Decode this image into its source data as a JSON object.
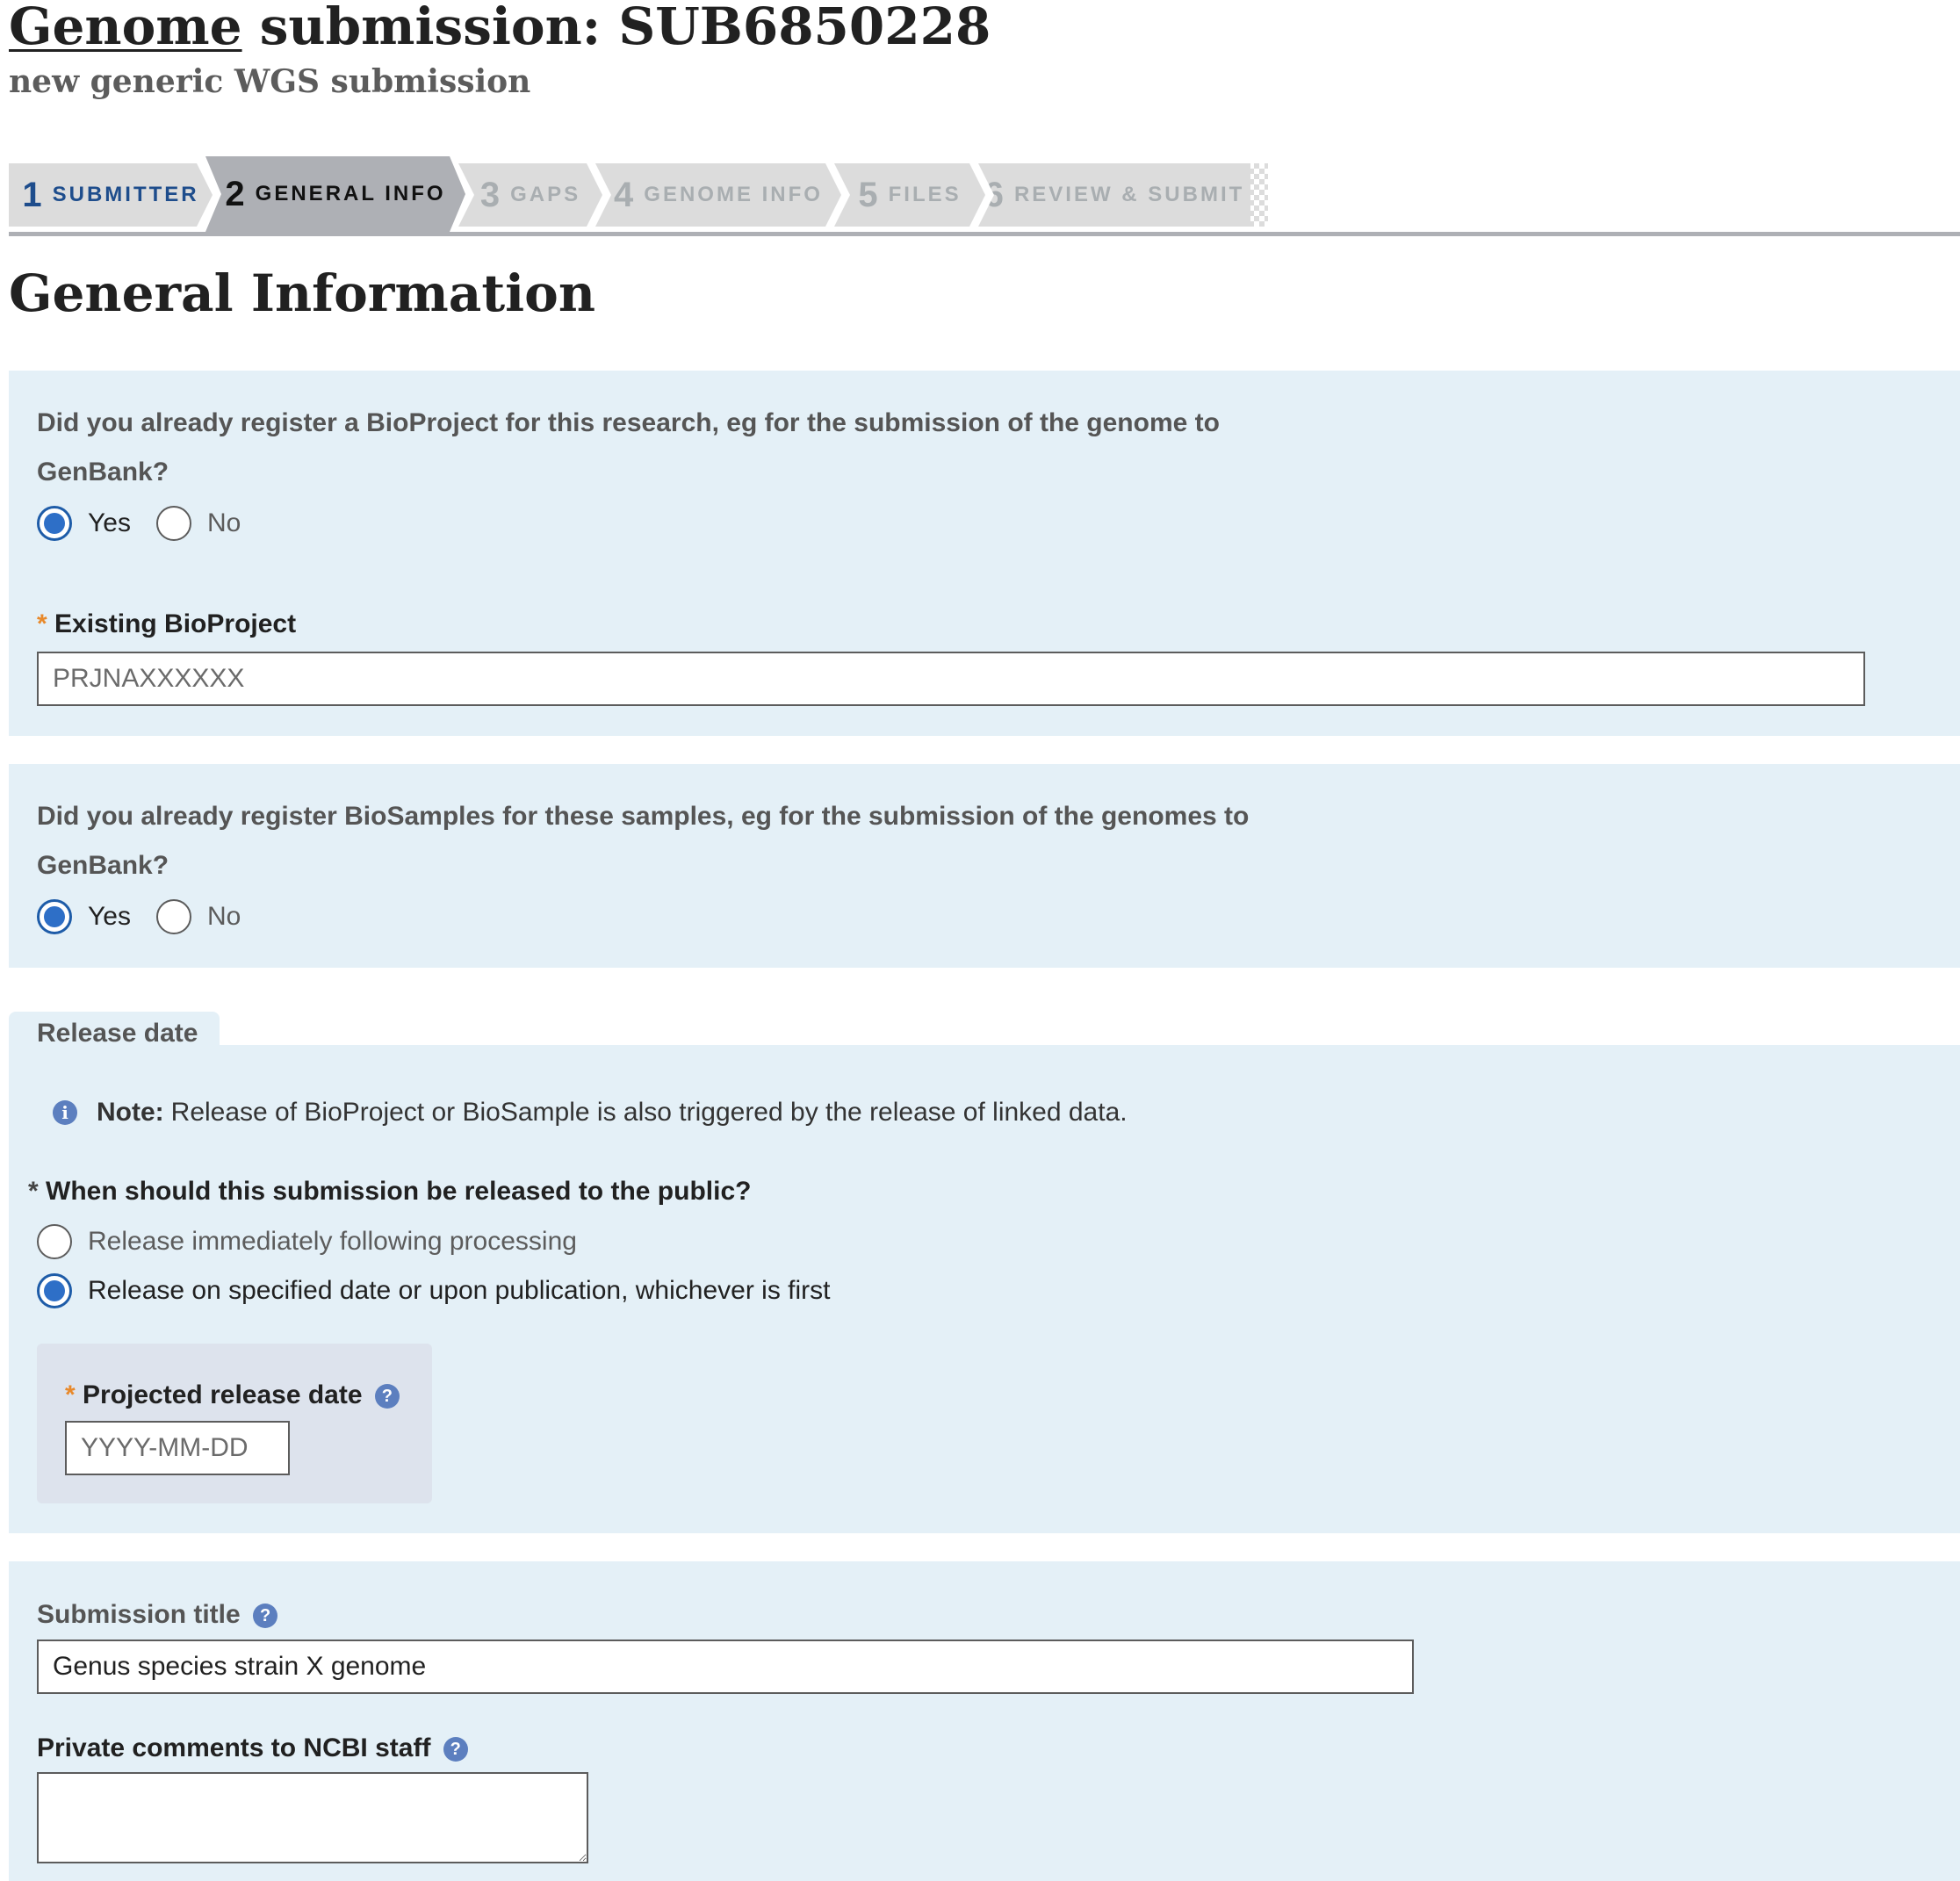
{
  "header": {
    "title_link": "Genome",
    "title_rest": "submission: SUB6850228",
    "subtitle": "new generic WGS submission"
  },
  "steps": [
    {
      "number": "1",
      "label": "SUBMITTER",
      "state": "done"
    },
    {
      "number": "2",
      "label": "GENERAL INFO",
      "state": "active"
    },
    {
      "number": "3",
      "label": "GAPS",
      "state": "upcoming"
    },
    {
      "number": "4",
      "label": "GENOME INFO",
      "state": "upcoming"
    },
    {
      "number": "5",
      "label": "FILES",
      "state": "upcoming"
    },
    {
      "number": "6",
      "label": "REVIEW & SUBMIT",
      "state": "upcoming"
    }
  ],
  "section_heading": "General Information",
  "bioproject": {
    "question_line1": "Did you already register a BioProject for this research, eg for the submission of the genome to",
    "question_line2": "GenBank?",
    "options": [
      {
        "label": "Yes",
        "selected": true
      },
      {
        "label": "No",
        "selected": false
      }
    ],
    "required_marker": "*",
    "existing_label": "Existing BioProject",
    "existing_placeholder": "PRJNAXXXXXX",
    "existing_value": ""
  },
  "biosample": {
    "question_line1": "Did you already register BioSamples for these samples, eg for the submission of the genomes to",
    "question_line2": "GenBank?",
    "options": [
      {
        "label": "Yes",
        "selected": true
      },
      {
        "label": "No",
        "selected": false
      }
    ]
  },
  "release": {
    "tab_label": "Release date",
    "note_icon": "info-icon",
    "note_bold": "Note:",
    "note_text": "Release of BioProject or BioSample is also triggered by the release of linked data.",
    "required_marker": "*",
    "question": "When should this submission be released to the public?",
    "options": [
      {
        "label": "Release immediately following processing",
        "selected": false
      },
      {
        "label": "Release on specified date or upon publication, whichever is first",
        "selected": true
      }
    ],
    "date_label": "Projected release date",
    "date_placeholder": "YYYY-MM-DD",
    "date_value": ""
  },
  "submission": {
    "title_label": "Submission title",
    "title_value": "Genus species strain X genome",
    "comments_label": "Private comments to NCBI staff",
    "comments_value": "",
    "help_icon": "?"
  },
  "colors": {
    "panel_bg": "#e4f0f7",
    "accent_blue": "#2e6fc7",
    "required_orange": "#e8892b",
    "step_done": "#1e4d8c",
    "step_active_bg": "#aeb0b5"
  }
}
